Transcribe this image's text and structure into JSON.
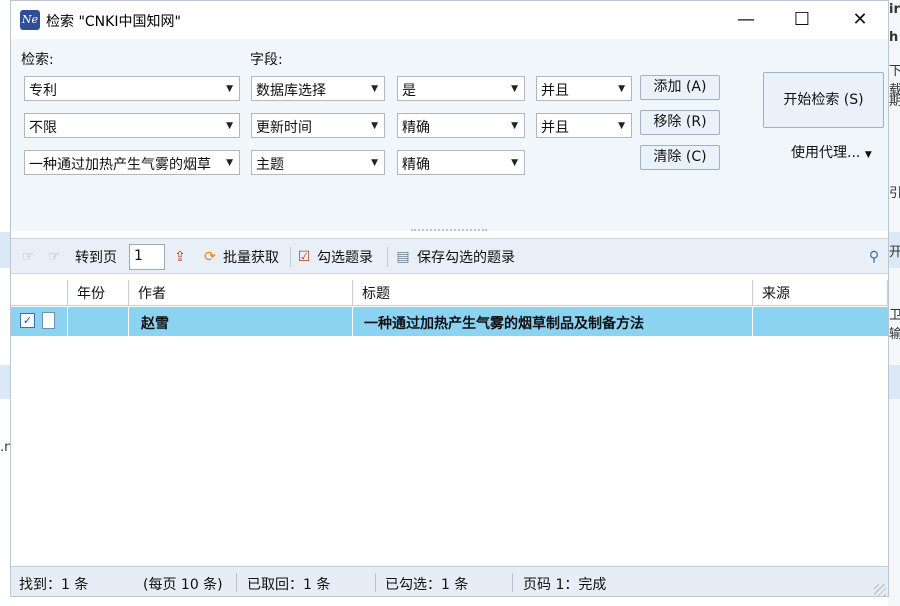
{
  "window": {
    "title": "检索 \"CNKI中国知网\"",
    "app_icon": "Ne"
  },
  "controls": {
    "minimize": "—",
    "maximize": "☐",
    "close": "✕"
  },
  "search": {
    "search_label": "检索:",
    "field_label": "字段:",
    "rows": [
      {
        "term": "专利",
        "field": "数据库选择",
        "value": "是",
        "logic": "并且"
      },
      {
        "term": "不限",
        "field": "更新时间",
        "value": "精确",
        "logic": "并且"
      },
      {
        "term": "一种通过加热产生气雾的烟草",
        "field": "主题",
        "value": "精确"
      }
    ],
    "add_label": "添加 (A)",
    "remove_label": "移除 (R)",
    "clear_label": "清除 (C)",
    "start_label": "开始检索 (S)",
    "proxy_label": "使用代理..."
  },
  "toolbar": {
    "goto_label": "转到页",
    "page_value": "1",
    "batch_label": "批量获取",
    "select_label": "勾选题录",
    "save_label": "保存勾选的题录"
  },
  "table": {
    "headers": {
      "year": "年份",
      "author": "作者",
      "title": "标题",
      "source": "来源"
    },
    "rows": [
      {
        "checked": "✓",
        "year": "",
        "author": "赵雪",
        "title": "一种通过加热产生气雾的烟草制品及制备方法",
        "source": ""
      }
    ]
  },
  "status": {
    "found": "找到：1 条",
    "per_page": "(每页 10 条)",
    "fetched": "已取回：1 条",
    "checked": "已勾选：1 条",
    "page": "页码 1：完成"
  },
  "background": {
    "t1": "ir",
    "t2": "h",
    "t3": "下载",
    "t4": "期-",
    "t5": "引",
    "t6": "开",
    "t7": "卫输",
    "t8": ".n"
  }
}
